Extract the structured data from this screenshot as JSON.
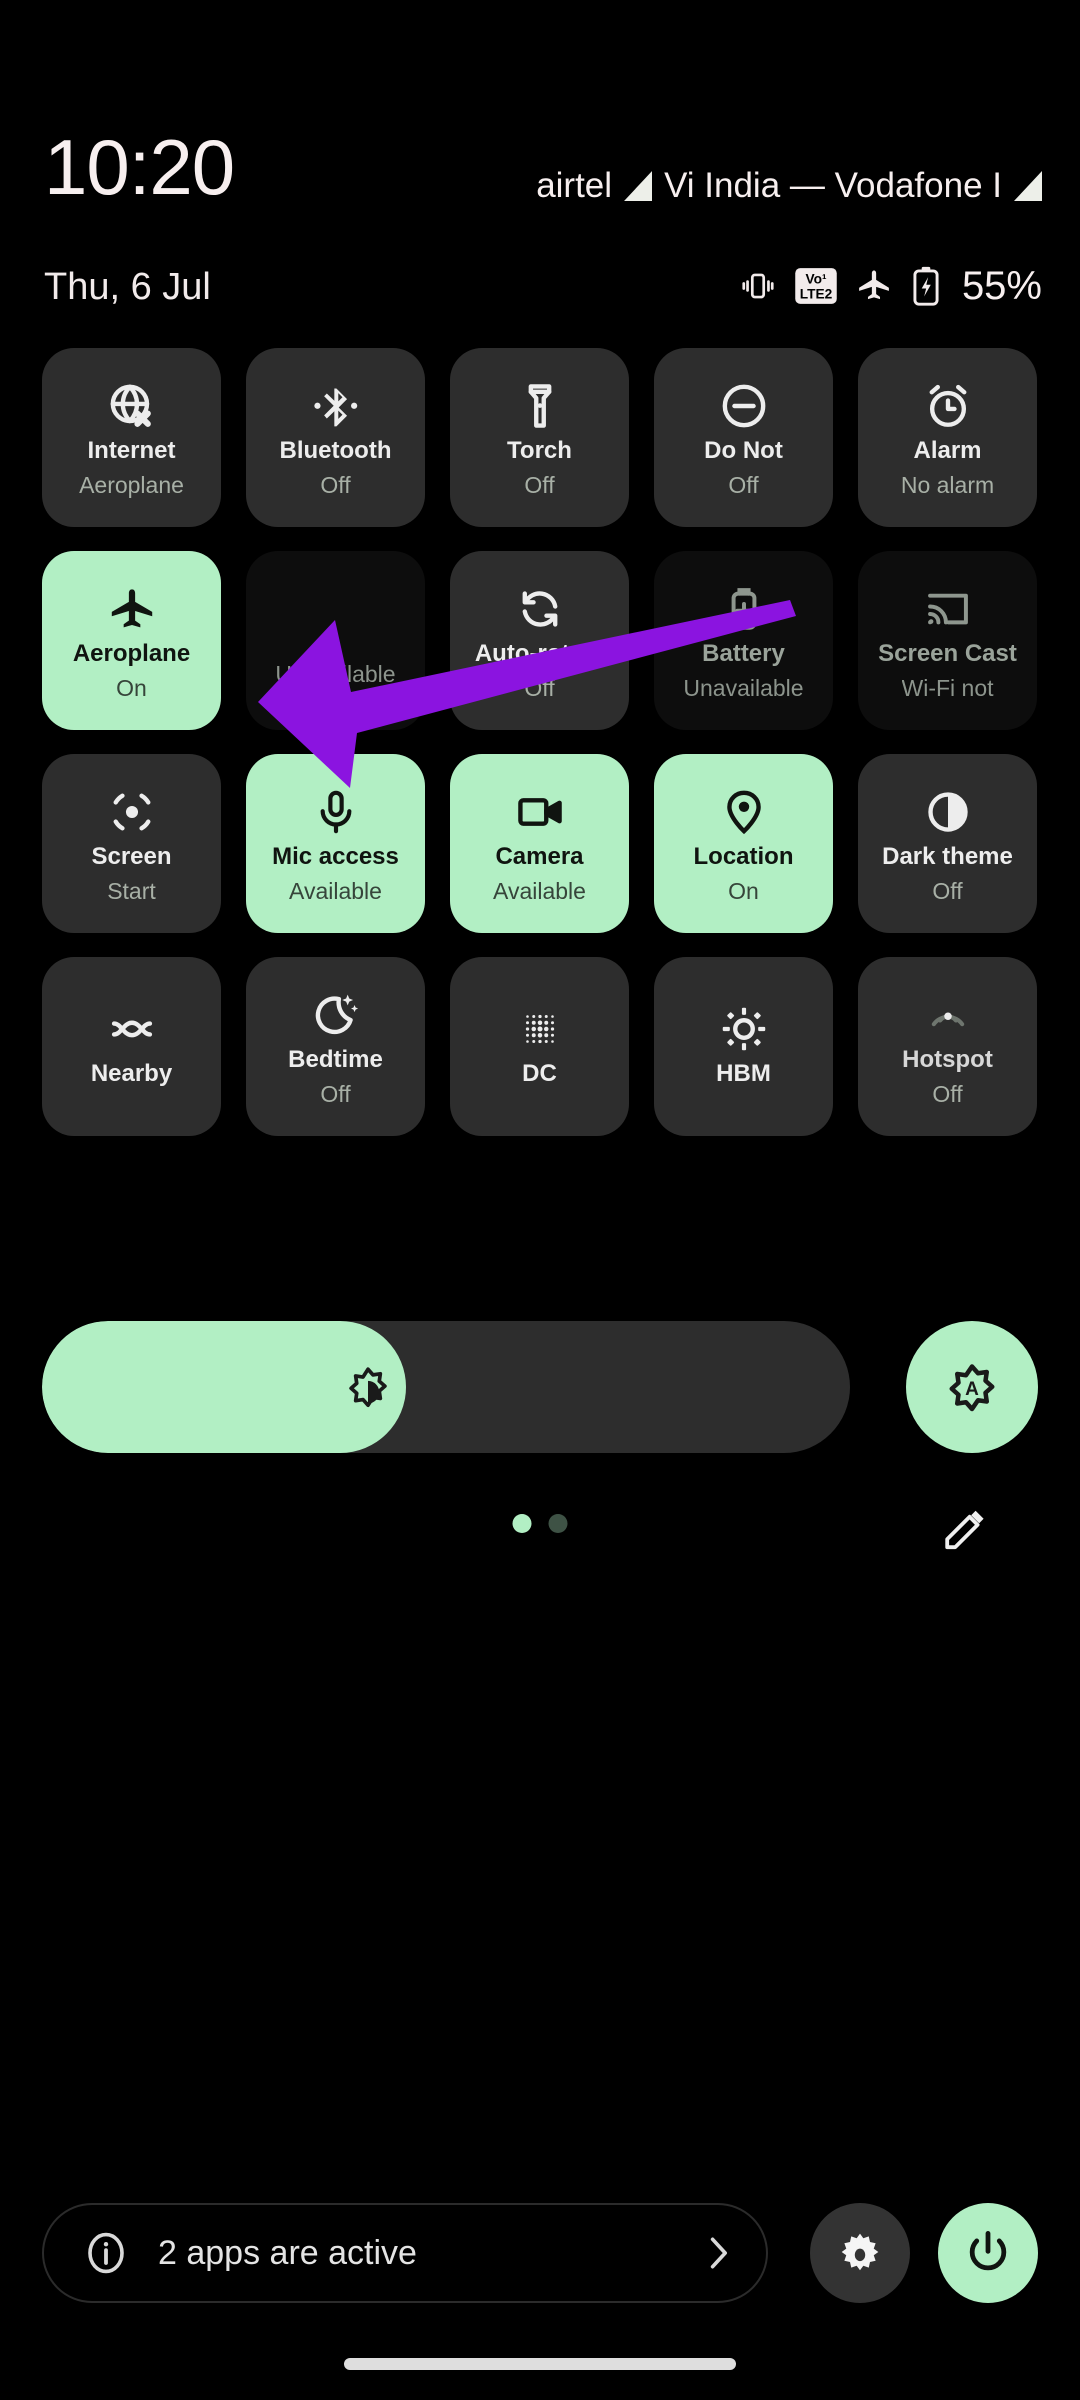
{
  "statusbar": {
    "clock": "10:20",
    "carrier_1": "airtel",
    "carrier_2": "Vi India — Vodafone I",
    "date": "Thu, 6 Jul",
    "battery_percent": "55%",
    "icons": [
      "vibrate-icon",
      "volte-icon",
      "airplane-icon",
      "battery-charging-icon"
    ],
    "volte_top": "Vo¹",
    "volte_bottom": "LTE2"
  },
  "tiles": [
    {
      "label": "Internet",
      "sub": "Aeroplane",
      "state": "off",
      "icon": "globe-off-icon"
    },
    {
      "label": "Bluetooth",
      "sub": "Off",
      "state": "off",
      "icon": "bluetooth-icon"
    },
    {
      "label": "Torch",
      "sub": "Off",
      "state": "off",
      "icon": "flashlight-icon"
    },
    {
      "label": "Do Not",
      "sub": "Off",
      "state": "off",
      "icon": "do-not-disturb-icon"
    },
    {
      "label": "Alarm",
      "sub": "No alarm",
      "state": "off",
      "icon": "alarm-clock-icon"
    },
    {
      "label": "Aeroplane",
      "sub": "On",
      "state": "active",
      "icon": "airplane-icon"
    },
    {
      "label": "",
      "sub": "Unavailable",
      "state": "disabled",
      "icon": "none-icon"
    },
    {
      "label": "Auto-rotate",
      "sub": "Off",
      "state": "off",
      "icon": "auto-rotate-icon"
    },
    {
      "label": "Battery",
      "sub": "Unavailable",
      "state": "disabled",
      "icon": "battery-saver-icon"
    },
    {
      "label": "Screen Cast",
      "sub": "Wi-Fi not",
      "state": "disabled",
      "icon": "screen-cast-icon"
    },
    {
      "label": "Screen",
      "sub": "Start",
      "state": "off",
      "icon": "screen-record-icon"
    },
    {
      "label": "Mic access",
      "sub": "Available",
      "state": "active",
      "icon": "microphone-icon"
    },
    {
      "label": "Camera",
      "sub": "Available",
      "state": "active",
      "icon": "camera-video-icon"
    },
    {
      "label": "Location",
      "sub": "On",
      "state": "active",
      "icon": "location-pin-icon"
    },
    {
      "label": "Dark theme",
      "sub": "Off",
      "state": "off",
      "icon": "dark-theme-icon"
    },
    {
      "label": "Nearby",
      "sub": "",
      "state": "off",
      "icon": "nearby-share-icon"
    },
    {
      "label": "Bedtime",
      "sub": "Off",
      "state": "off",
      "icon": "bedtime-moon-icon"
    },
    {
      "label": "DC",
      "sub": "",
      "state": "off",
      "icon": "dc-dimming-icon"
    },
    {
      "label": "HBM",
      "sub": "",
      "state": "off",
      "icon": "brightness-sun-icon"
    },
    {
      "label": "Hotspot",
      "sub": "Off",
      "state": "dim",
      "icon": "hotspot-icon"
    }
  ],
  "brightness": {
    "value_percent": 45,
    "slider_icon": "brightness-icon",
    "auto_icon": "auto-brightness-icon"
  },
  "pager": {
    "page_count": 2,
    "active_page": 1,
    "edit_icon": "edit-pencil-icon"
  },
  "bottom": {
    "apps_active_label": "2 apps are active",
    "info_icon": "info-icon",
    "chevron_icon": "chevron-right-icon",
    "settings_icon": "gear-icon",
    "power_icon": "power-icon"
  },
  "overlay": {
    "arrow_color": "#8B14E0",
    "arrow_points_to": "Aeroplane"
  },
  "colors": {
    "accent_green": "#B2EFC4",
    "tile_bg": "#2D2D2D",
    "tile_disabled_bg": "#0D0D0D",
    "background": "#000000"
  }
}
